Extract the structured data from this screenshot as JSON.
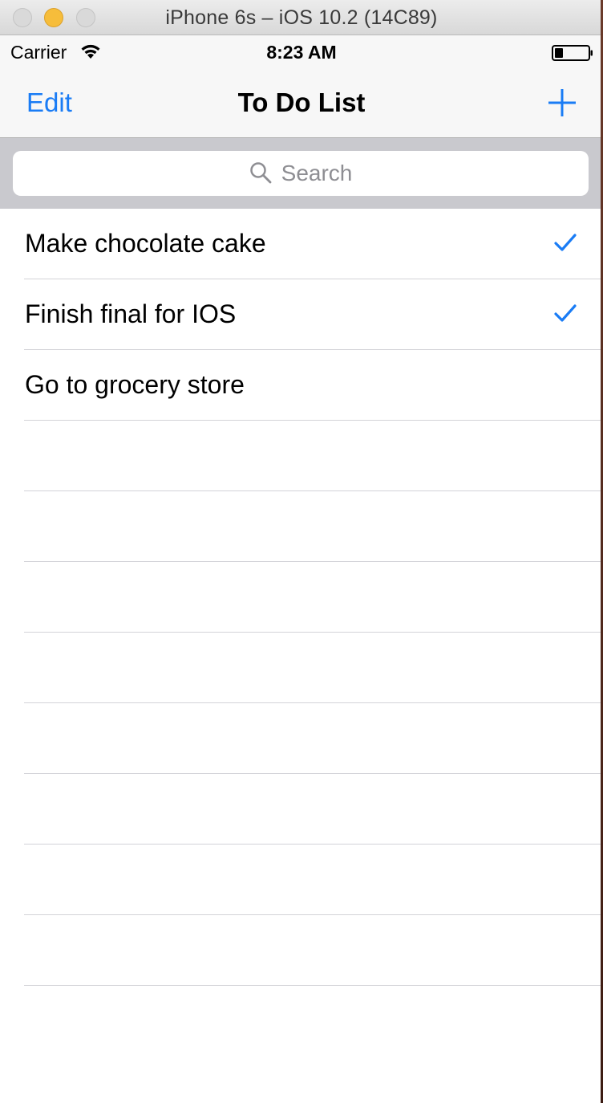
{
  "window": {
    "title": "iPhone 6s – iOS 10.2 (14C89)"
  },
  "status_bar": {
    "carrier": "Carrier",
    "time": "8:23 AM"
  },
  "nav": {
    "edit_label": "Edit",
    "title": "To Do List"
  },
  "search": {
    "placeholder": "Search"
  },
  "colors": {
    "accent": "#1a7cf5",
    "separator": "#d3d3d8",
    "search_background": "#c9c9ce"
  },
  "todos": [
    {
      "text": "Make chocolate cake",
      "done": true
    },
    {
      "text": "Finish final for IOS",
      "done": true
    },
    {
      "text": "Go to grocery store",
      "done": false
    }
  ]
}
